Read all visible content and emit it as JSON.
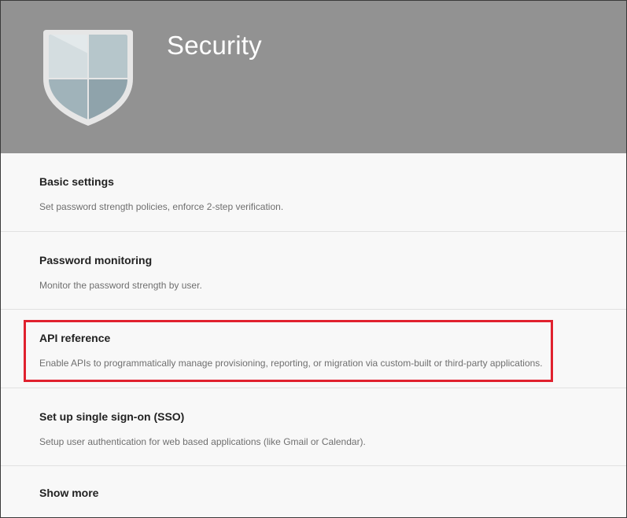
{
  "header": {
    "title": "Security",
    "icon": "shield-icon"
  },
  "sections": [
    {
      "title": "Basic settings",
      "description": "Set password strength policies, enforce 2-step verification."
    },
    {
      "title": "Password monitoring",
      "description": "Monitor the password strength by user."
    },
    {
      "title": "API reference",
      "description": "Enable APIs to programmatically manage provisioning, reporting, or migration via custom-built or third-party applications."
    },
    {
      "title": "Set up single sign-on (SSO)",
      "description": "Setup user authentication for web based applications (like Gmail or Calendar)."
    }
  ],
  "show_more_label": "Show more",
  "colors": {
    "header_bg": "#929292",
    "highlight": "#e0212e",
    "section_bg": "#f8f8f8"
  }
}
